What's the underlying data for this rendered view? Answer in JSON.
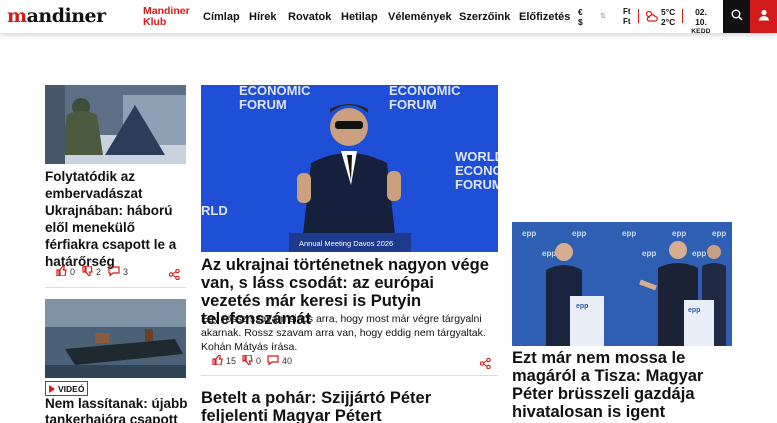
{
  "header": {
    "logo": "mandiner",
    "klub_line1": "Mandiner",
    "klub_line2": "Klub",
    "nav": [
      "Címlap",
      "Hírek",
      "Rovatok",
      "Hetilap",
      "Vélemények",
      "Szerzőink",
      "Előfizetés"
    ],
    "fx_symbols": [
      "€",
      "$"
    ],
    "fx_units": [
      "Ft",
      "Ft"
    ],
    "temp_high": "5°C",
    "temp_low": "2°C",
    "date": "02. 10.",
    "weekday": "KEDD",
    "colors": {
      "brand": "#d31b1b",
      "dark": "#111111"
    }
  },
  "articles": {
    "left1": {
      "title": "Folytatódik az embervadászat Ukrajnában: háború elől menekülő férfiakra csapott le a határőrség",
      "likes": "0",
      "dislikes": "2",
      "comments": "3"
    },
    "left2": {
      "badge": "VIDEÓ",
      "title": "Nem lassítanak: újabb tankerhajóra csapott"
    },
    "main": {
      "title": "Az ukrajnai történetnek nagyon vége van, s láss csodát: az európai vezetés már keresi is Putyin telefonszámát",
      "lead": "Egy rossz szavam sincs arra, hogy most már végre tárgyalni akarnak. Rossz szavam arra van, hogy eddig nem tárgyaltak. Kohán Mátyás írása.",
      "likes": "15",
      "dislikes": "0",
      "comments": "40"
    },
    "main2": {
      "title": "Betelt a pohár: Szijjártó Péter feljelenti Magyar Pétert"
    },
    "right": {
      "title": "Ezt már nem mossa le magáról a Tisza: Magyar Péter brüsszeli gazdája hivatalosan is igent mondott"
    }
  }
}
